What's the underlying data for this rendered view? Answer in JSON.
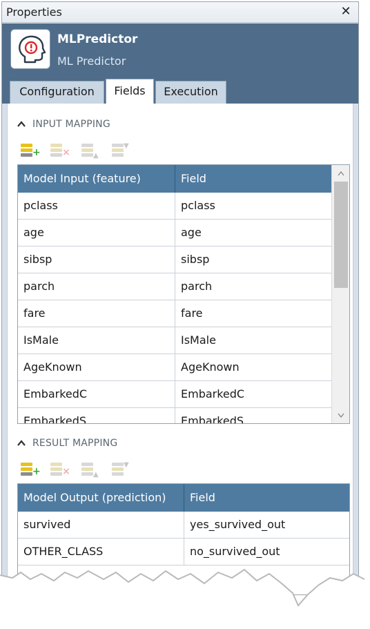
{
  "window": {
    "title": "Properties",
    "close_glyph": "✕"
  },
  "header": {
    "name": "MLPredictor",
    "type": "ML Predictor",
    "icon": "ml-head-icon"
  },
  "tabs": [
    {
      "label": "Configuration",
      "active": false
    },
    {
      "label": "Fields",
      "active": true
    },
    {
      "label": "Execution",
      "active": false
    }
  ],
  "input_mapping": {
    "title": "INPUT MAPPING",
    "toolbar": [
      "add-row-icon",
      "delete-row-icon",
      "move-down-icon",
      "move-up-icon"
    ],
    "columns": [
      "Model Input (feature)",
      "Field"
    ],
    "rows": [
      [
        "pclass",
        "pclass"
      ],
      [
        "age",
        "age"
      ],
      [
        "sibsp",
        "sibsp"
      ],
      [
        "parch",
        "parch"
      ],
      [
        "fare",
        "fare"
      ],
      [
        "IsMale",
        "IsMale"
      ],
      [
        "AgeKnown",
        "AgeKnown"
      ],
      [
        "EmbarkedC",
        "EmbarkedC"
      ],
      [
        "EmbarkedS",
        "EmbarkedS"
      ]
    ],
    "scroll_up": "⌃",
    "scroll_down": "⌄"
  },
  "result_mapping": {
    "title": "RESULT MAPPING",
    "toolbar": [
      "add-row-icon",
      "delete-row-icon",
      "move-down-icon",
      "move-up-icon"
    ],
    "columns": [
      "Model Output (prediction)",
      "Field"
    ],
    "rows": [
      [
        "survived",
        "yes_survived_out"
      ],
      [
        "OTHER_CLASS",
        "no_survived_out"
      ]
    ]
  },
  "colors": {
    "header": "#4f6d8a",
    "grid_header": "#4f7ba0",
    "add_green": "#3aa63a",
    "add_yellow": "#e7c21b",
    "delete_red": "#e05a5a"
  },
  "section_chevron": "^"
}
